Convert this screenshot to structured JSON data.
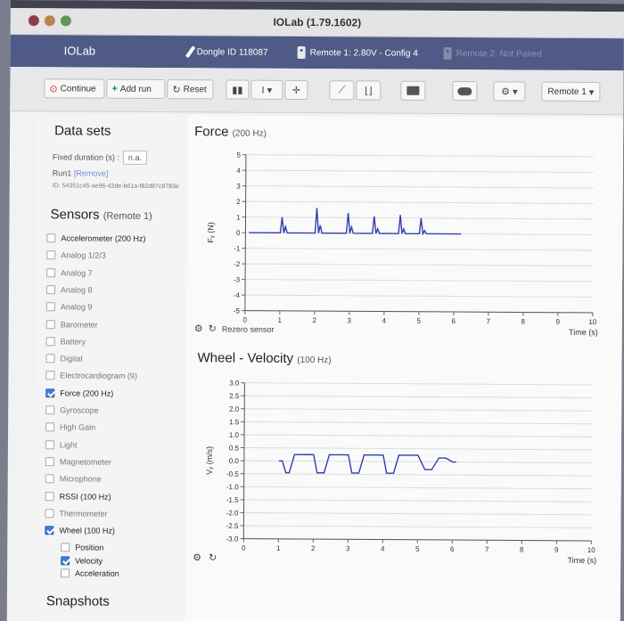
{
  "window": {
    "title": "IOLab (1.79.1602)"
  },
  "header": {
    "brand": "IOLab",
    "dongle": "Dongle ID 118087",
    "remote1": "Remote 1: 2.80V - Config 4",
    "remote2": "Remote 2: Not Paired"
  },
  "toolbar": {
    "continue_label": "Continue",
    "add_run_label": "Add run",
    "reset_label": "Reset",
    "remote_select": "Remote 1"
  },
  "datasets": {
    "heading": "Data sets",
    "fixed_duration_label": "Fixed duration (s) :",
    "fixed_duration_value": "n.a.",
    "run_label": "Run1",
    "remove_label": "[Remove]",
    "run_id": "ID: 54351c45-ae96-42de-b61a-f82d87c8783e"
  },
  "sensors": {
    "heading": "Sensors",
    "heading_sub": "(Remote 1)",
    "items": [
      {
        "label": "Accelerometer (200 Hz)",
        "checked": false,
        "active": true
      },
      {
        "label": "Analog 1/2/3",
        "checked": false,
        "active": false
      },
      {
        "label": "Analog 7",
        "checked": false,
        "active": false
      },
      {
        "label": "Analog 8",
        "checked": false,
        "active": false
      },
      {
        "label": "Analog 9",
        "checked": false,
        "active": false
      },
      {
        "label": "Barometer",
        "checked": false,
        "active": false
      },
      {
        "label": "Battery",
        "checked": false,
        "active": false
      },
      {
        "label": "Digital",
        "checked": false,
        "active": false
      },
      {
        "label": "Electrocardiogram (9)",
        "checked": false,
        "active": false
      },
      {
        "label": "Force (200 Hz)",
        "checked": true,
        "active": true
      },
      {
        "label": "Gyroscope",
        "checked": false,
        "active": false
      },
      {
        "label": "High Gain",
        "checked": false,
        "active": false
      },
      {
        "label": "Light",
        "checked": false,
        "active": false
      },
      {
        "label": "Magnetometer",
        "checked": false,
        "active": false
      },
      {
        "label": "Microphone",
        "checked": false,
        "active": false
      },
      {
        "label": "RSSI (100 Hz)",
        "checked": false,
        "active": true
      },
      {
        "label": "Thermometer",
        "checked": false,
        "active": false
      },
      {
        "label": "Wheel (100 Hz)",
        "checked": true,
        "active": true
      }
    ],
    "wheel_sub": [
      {
        "label": "Position",
        "checked": false
      },
      {
        "label": "Velocity",
        "checked": true
      },
      {
        "label": "Acceleration",
        "checked": false
      }
    ]
  },
  "snapshots": {
    "heading": "Snapshots"
  },
  "force_chart": {
    "title": "Force",
    "title_sub": "(200 Hz)",
    "rezero_label": "Rezero sensor"
  },
  "wheel_chart": {
    "title": "Wheel - Velocity",
    "title_sub": "(100 Hz)"
  },
  "colors": {
    "accent": "#3c7fd9",
    "trace": "#2f3fb0",
    "header": "#4f5b86"
  },
  "chart_data": [
    {
      "type": "line",
      "title": "Force (200 Hz)",
      "xlabel": "Time (s)",
      "ylabel": "Fᵧ (N)",
      "xlim": [
        0,
        10
      ],
      "ylim": [
        -5,
        5
      ],
      "x_ticks": [
        "0",
        "1",
        "2",
        "3",
        "4",
        "5",
        "6",
        "7",
        "8",
        "9",
        "10"
      ],
      "y_ticks": [
        "5",
        "4",
        "3",
        "2",
        "1",
        "0",
        "-1",
        "-2",
        "-3",
        "-4",
        "-5"
      ],
      "grid": true,
      "series": [
        {
          "x": [
            0.1,
            1.0,
            1.05,
            1.1,
            1.15,
            1.2,
            1.5,
            2.0,
            2.05,
            2.1,
            2.15,
            2.2,
            2.5,
            2.9,
            2.95,
            3.0,
            3.05,
            3.1,
            3.4,
            3.65,
            3.7,
            3.75,
            3.8,
            3.85,
            4.1,
            4.4,
            4.45,
            4.5,
            4.55,
            4.6,
            4.9,
            5.0,
            5.05,
            5.1,
            5.15,
            5.2,
            5.5,
            6.2
          ],
          "y": [
            0.0,
            0.0,
            1.0,
            0.0,
            0.4,
            0.0,
            0.0,
            0.0,
            1.6,
            0.0,
            0.5,
            0.0,
            0.0,
            0.0,
            1.3,
            0.0,
            0.4,
            0.0,
            0.0,
            0.0,
            1.1,
            0.0,
            0.3,
            0.0,
            0.0,
            0.0,
            1.2,
            0.0,
            0.3,
            0.0,
            0.0,
            0.0,
            1.0,
            0.0,
            0.2,
            0.0,
            0.0,
            0.0
          ]
        }
      ]
    },
    {
      "type": "line",
      "title": "Wheel - Velocity (100 Hz)",
      "xlabel": "Time (s)",
      "ylabel": "Vᵧ (m/s)",
      "xlim": [
        0,
        10
      ],
      "ylim": [
        -3.0,
        3.0
      ],
      "x_ticks": [
        "0",
        "1",
        "2",
        "3",
        "4",
        "5",
        "6",
        "7",
        "8",
        "9",
        "10"
      ],
      "y_ticks": [
        "3.0",
        "2.5",
        "2.0",
        "1.5",
        "1.0",
        "0.5",
        "0.0",
        "-0.5",
        "-1.0",
        "-1.5",
        "-2.0",
        "-2.5",
        "-3.0"
      ],
      "grid": true,
      "series": [
        {
          "x": [
            1.0,
            1.1,
            1.2,
            1.3,
            1.45,
            1.6,
            1.8,
            2.0,
            2.1,
            2.3,
            2.45,
            2.6,
            2.8,
            3.0,
            3.1,
            3.3,
            3.45,
            3.6,
            3.8,
            4.0,
            4.1,
            4.3,
            4.45,
            4.6,
            4.8,
            5.0,
            5.2,
            5.4,
            5.6,
            5.8,
            6.0,
            6.1
          ],
          "y": [
            0.0,
            0.0,
            -0.45,
            -0.45,
            0.25,
            0.25,
            0.25,
            0.25,
            -0.45,
            -0.45,
            0.25,
            0.25,
            0.25,
            0.25,
            -0.45,
            -0.45,
            0.25,
            0.25,
            0.25,
            0.25,
            -0.45,
            -0.45,
            0.25,
            0.25,
            0.25,
            0.25,
            -0.3,
            -0.3,
            0.15,
            0.15,
            0.0,
            0.0
          ]
        }
      ]
    }
  ]
}
